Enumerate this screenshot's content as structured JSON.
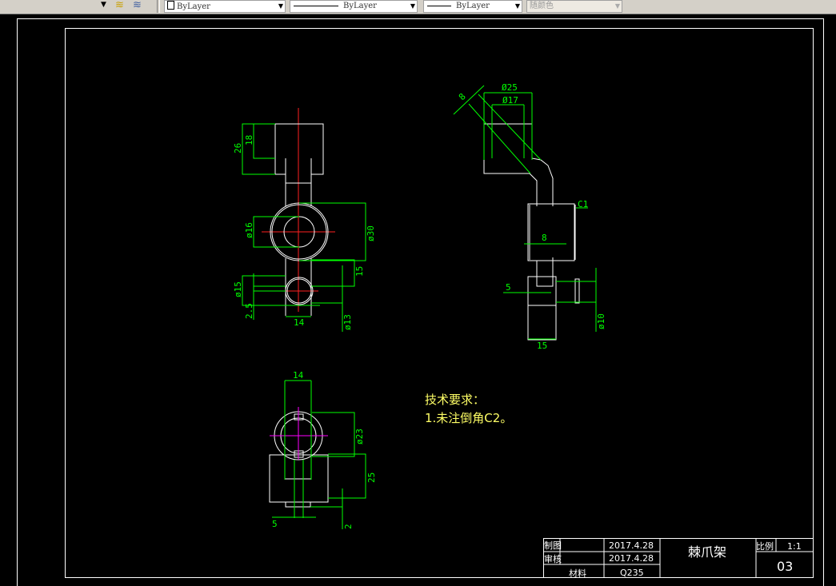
{
  "toolbar": {
    "layer_icons": [
      "layer-previous-icon",
      "layer-states-icon"
    ],
    "color_combo": "ByLayer",
    "linetype_combo": "ByLayer",
    "lineweight_combo": "ByLayer",
    "plotstyle_combo": "随颜色"
  },
  "drawing": {
    "front_view_dims": {
      "d26": "26",
      "d18": "18",
      "d16": "ø16",
      "d30": "ø30",
      "d15": "15",
      "d15b": "ø15",
      "d25": "2.5",
      "d14": "14",
      "d13": "ø13"
    },
    "side_view_dims": {
      "d25": "Ø25",
      "d17": "Ø17",
      "d8a": "8",
      "c1": "C1",
      "d8b": "8",
      "d5": "5",
      "d15": "15",
      "d10": "ø10"
    },
    "bottom_view_dims": {
      "d14": "14",
      "d23": "ø23",
      "d25": "25",
      "d5": "5",
      "d2": "2"
    },
    "notes": {
      "title": "技术要求：",
      "item1": "1.未注倒角C2。"
    },
    "title_block": {
      "drawn_label": "制图",
      "drawn_date": "2017.4.28",
      "checked_label": "审核",
      "checked_date": "2017.4.28",
      "material_label": "材料",
      "material": "Q235",
      "part_name": "棘爪架",
      "scale_label": "比例",
      "scale": "1:1",
      "drawing_no": "03"
    }
  },
  "colors": {
    "background": "#000000",
    "geometry": "#ffffff",
    "dimension": "#00ff00",
    "centerline": "#ff2020",
    "notes": "#ffff66"
  }
}
